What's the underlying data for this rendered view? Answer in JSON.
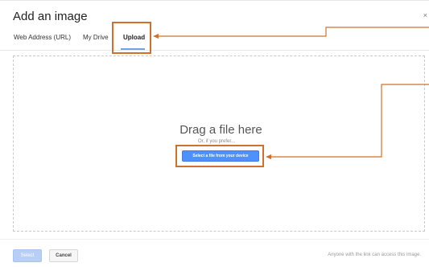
{
  "dialog": {
    "title": "Add an image",
    "close_label": "×"
  },
  "tabs": [
    {
      "label": "Web Address (URL)"
    },
    {
      "label": "My Drive"
    },
    {
      "label": "Upload",
      "active": true
    }
  ],
  "upload": {
    "drag_text": "Drag a file here",
    "prefer_text": "Or, if you prefer...",
    "select_device_label": "Select a file from your device"
  },
  "footer": {
    "select_label": "Select",
    "cancel_label": "Cancel",
    "note": "Anyone with the link can access this image."
  },
  "colors": {
    "accent": "#4d90fe",
    "annotation": "#d0702c"
  }
}
